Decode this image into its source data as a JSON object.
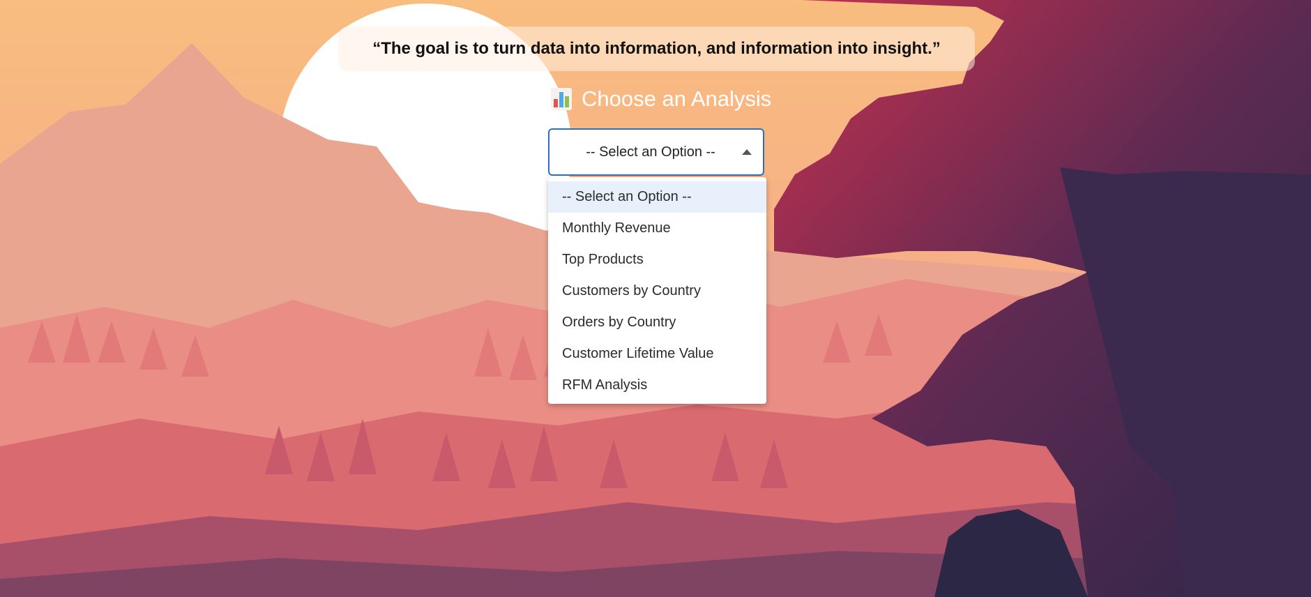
{
  "quote": "“The goal is to turn data into information, and information into insight.”",
  "heading": {
    "icon": "bar-chart-icon",
    "text": "Choose an Analysis"
  },
  "select": {
    "value": "-- Select an Option --",
    "options": [
      "-- Select an Option --",
      "Monthly Revenue",
      "Top Products",
      "Customers by Country",
      "Orders by Country",
      "Customer Lifetime Value",
      "RFM Analysis"
    ],
    "highlighted_index": 0
  },
  "colors": {
    "accent_border": "#2f6fb3",
    "highlight": "#e8f1fb"
  }
}
